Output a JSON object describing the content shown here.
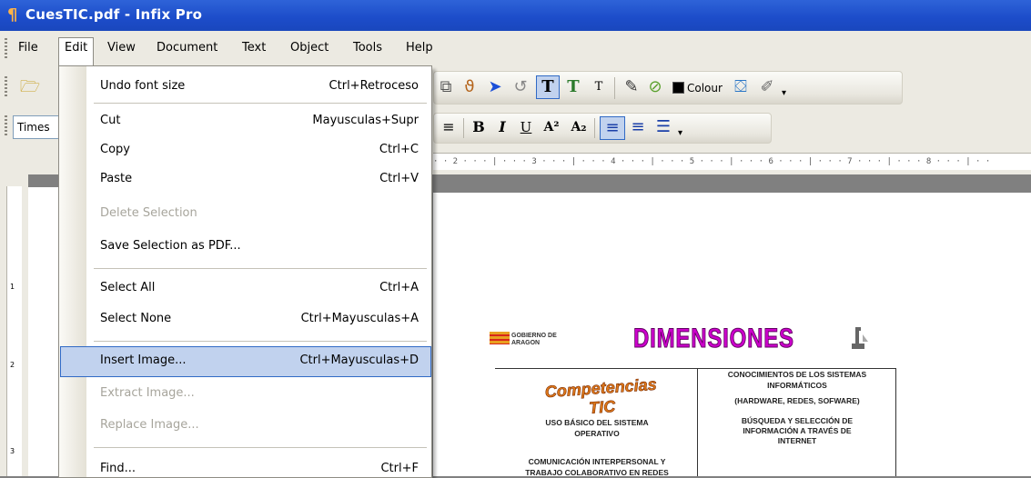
{
  "window": {
    "title": "CuesTIC.pdf - Infix Pro"
  },
  "menubar": {
    "items": [
      "File",
      "Edit",
      "View",
      "Document",
      "Text",
      "Object",
      "Tools",
      "Help"
    ]
  },
  "toolbar": {
    "colour_label": "Colour",
    "font_name": "Times",
    "bold": "B",
    "italic": "I",
    "underline": "U",
    "superscript": "A²",
    "subscript": "A₂",
    "text_tool": "T"
  },
  "ruler": {
    "text": "· · 2 · · · | · · · 3 · · · | · · · 4 · · · | · · · 5 · · · | · · · 6 · · · | · · · 7 · · · | · · · 8 · · · | · ·"
  },
  "vruler": {
    "marks": [
      "1",
      "2",
      "3"
    ]
  },
  "edit_menu": {
    "items": [
      {
        "label": "Undo font size",
        "shortcut": "Ctrl+Retroceso",
        "enabled": true
      },
      {
        "label": "Cut",
        "shortcut": "Mayusculas+Supr",
        "enabled": true
      },
      {
        "label": "Copy",
        "shortcut": "Ctrl+C",
        "enabled": true
      },
      {
        "label": "Paste",
        "shortcut": "Ctrl+V",
        "enabled": true
      },
      {
        "label": "Delete Selection",
        "shortcut": "",
        "enabled": false
      },
      {
        "label": "Save Selection as PDF...",
        "shortcut": "",
        "enabled": true
      },
      {
        "label": "Select All",
        "shortcut": "Ctrl+A",
        "enabled": true
      },
      {
        "label": "Select None",
        "shortcut": "Ctrl+Mayusculas+A",
        "enabled": true
      },
      {
        "label": "Insert Image...",
        "shortcut": "Ctrl+Mayusculas+D",
        "enabled": true,
        "highlighted": true
      },
      {
        "label": "Extract Image...",
        "shortcut": "",
        "enabled": false
      },
      {
        "label": "Replace Image...",
        "shortcut": "",
        "enabled": false
      },
      {
        "label": "Find...",
        "shortcut": "Ctrl+F",
        "enabled": true
      }
    ]
  },
  "document": {
    "gov_logo": "GOBIERNO DE ARAGON",
    "heading": "DIMENSIONES",
    "competencias": "Competencias TIC",
    "cell_knowledge_1": "CONOCIMIENTOS DE LOS SISTEMAS",
    "cell_knowledge_2": "INFORMÁTICOS",
    "cell_knowledge_3": "(HARDWARE, REDES, SOFWARE)",
    "cell_basic_1": "USO BÁSICO DEL SISTEMA",
    "cell_basic_2": "OPERATIVO",
    "cell_search_1": "BÚSQUEDA Y SELECCIÓN DE",
    "cell_search_2": "INFORMACIÓN A TRAVÉS DE",
    "cell_search_3": "INTERNET",
    "cell_comm_1": "COMUNICACIÓN INTERPERSONAL Y",
    "cell_comm_2": "TRABAJO COLABORATIVO EN REDES"
  },
  "colors": {
    "titlebar": "#1c4cc9",
    "menu_highlight": "#c1d2ee",
    "heading": "#cc00cc"
  }
}
